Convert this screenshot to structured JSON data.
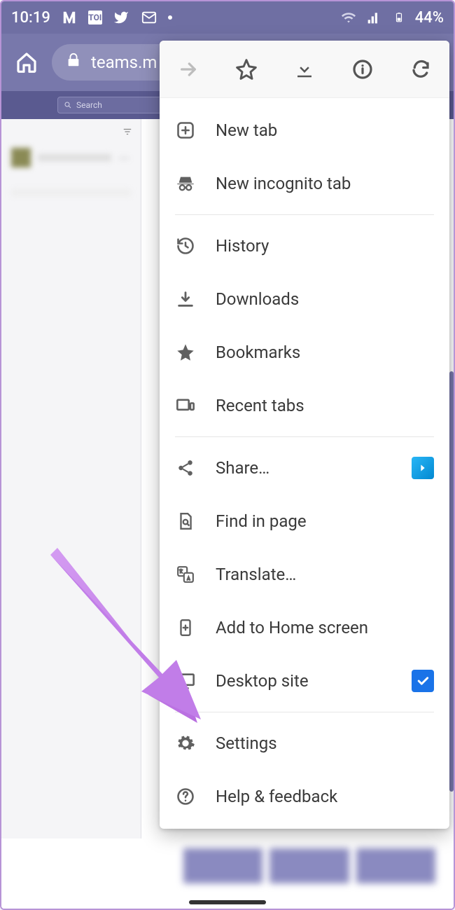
{
  "status": {
    "time": "10:19",
    "battery": "44%",
    "notif_labels": [
      "M",
      "TOI"
    ]
  },
  "address": {
    "url_display": "teams.m"
  },
  "teams": {
    "search_placeholder": "Search"
  },
  "menu": {
    "new_tab": "New tab",
    "new_incognito": "New incognito tab",
    "history": "History",
    "downloads": "Downloads",
    "bookmarks": "Bookmarks",
    "recent_tabs": "Recent tabs",
    "share": "Share…",
    "find_in_page": "Find in page",
    "translate": "Translate…",
    "add_to_home": "Add to Home screen",
    "desktop_site": "Desktop site",
    "settings": "Settings",
    "help": "Help & feedback",
    "desktop_site_checked": true
  }
}
